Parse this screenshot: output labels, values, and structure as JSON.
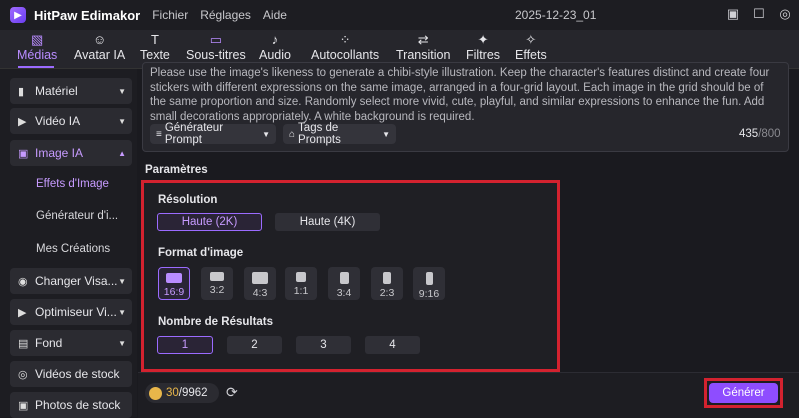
{
  "app": {
    "title": "HitPaw Edimakor",
    "project_name": "2025-12-23_01",
    "menu": [
      "Fichier",
      "Réglages",
      "Aide"
    ]
  },
  "tabs": [
    {
      "label": "Médias",
      "icon": "media-icon"
    },
    {
      "label": "Avatar IA",
      "icon": "avatar-icon"
    },
    {
      "label": "Texte",
      "icon": "text-icon"
    },
    {
      "label": "Sous-titres",
      "icon": "subtitles-icon"
    },
    {
      "label": "Audio",
      "icon": "audio-icon"
    },
    {
      "label": "Autocollants",
      "icon": "stickers-icon"
    },
    {
      "label": "Transition",
      "icon": "transition-icon"
    },
    {
      "label": "Filtres",
      "icon": "filters-icon"
    },
    {
      "label": "Effets",
      "icon": "effects-icon"
    }
  ],
  "sidebar": {
    "items": [
      {
        "label": "Matériel"
      },
      {
        "label": "Vidéo IA"
      },
      {
        "label": "Image IA"
      },
      {
        "label": "Changer Visa..."
      },
      {
        "label": "Optimiseur Vi..."
      },
      {
        "label": "Fond"
      },
      {
        "label": "Vidéos de stock"
      },
      {
        "label": "Photos de stock"
      }
    ],
    "subitems": [
      "Effets d'Image",
      "Générateur d'i...",
      "Mes Créations"
    ]
  },
  "prompt": {
    "text": "Please use the image's likeness to generate a chibi-style illustration. Keep the character's features distinct and create four stickers with different expressions on the same image, arranged in a four-grid layout. Each image in the grid should be of the same proportion and size. Randomly select more vivid, cute, playful, and similar expressions to enhance the fun. Add small decorations appropriately. A white background is required.",
    "generator_label": "Générateur Prompt",
    "tags_label": "Tags de Prompts",
    "count": "435",
    "max": "/800"
  },
  "params": {
    "title": "Paramètres",
    "resolution_label": "Résolution",
    "resolutions": [
      "Haute (2K)",
      "Haute (4K)"
    ],
    "format_label": "Format d'image",
    "formats": [
      "16:9",
      "3:2",
      "4:3",
      "1:1",
      "3:4",
      "2:3",
      "9:16"
    ],
    "results_label": "Nombre de Résultats",
    "results": [
      "1",
      "2",
      "3",
      "4"
    ]
  },
  "credits": {
    "current": "30",
    "total": "/9962"
  },
  "generate_label": "Générer",
  "colors": {
    "accent": "#9b6bff",
    "highlight": "#d3222f",
    "button": "#8e4dff"
  }
}
